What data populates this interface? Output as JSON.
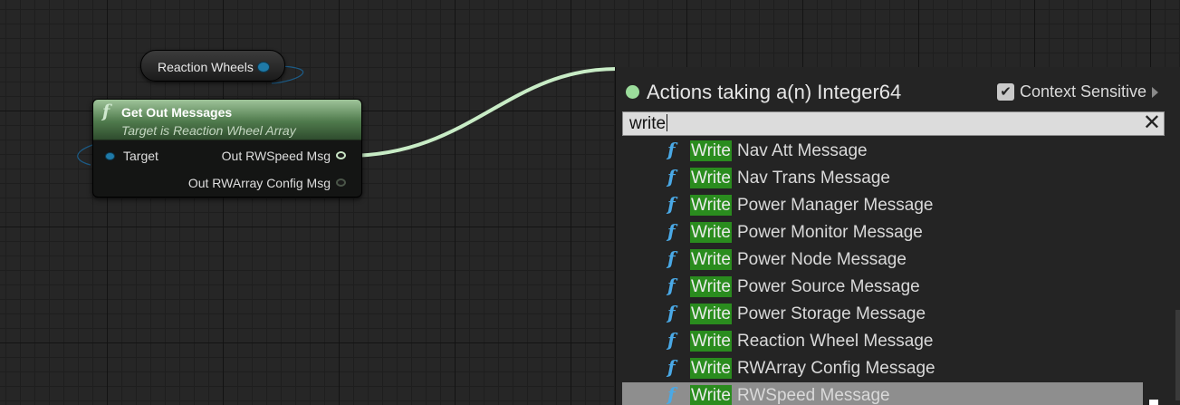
{
  "variable_node": {
    "label": "Reaction Wheels"
  },
  "function_node": {
    "title": "Get Out Messages",
    "subtitle": "Target is Reaction Wheel Array",
    "input_pin": "Target",
    "output_pins": [
      "Out RWSpeed Msg",
      "Out RWArray Config Msg"
    ]
  },
  "action_menu": {
    "title": "Actions taking a(n) Integer64",
    "context_sensitive": {
      "label": "Context Sensitive",
      "checked": true,
      "check_glyph": "✔"
    },
    "search": {
      "value": "write",
      "clear_glyph": "✕"
    },
    "function_glyph": "f",
    "items": [
      {
        "highlight": "Write",
        "rest": "Nav Att Message"
      },
      {
        "highlight": "Write",
        "rest": "Nav Trans Message"
      },
      {
        "highlight": "Write",
        "rest": "Power Manager Message"
      },
      {
        "highlight": "Write",
        "rest": "Power Monitor Message"
      },
      {
        "highlight": "Write",
        "rest": "Power Node Message"
      },
      {
        "highlight": "Write",
        "rest": "Power Source Message"
      },
      {
        "highlight": "Write",
        "rest": "Power Storage Message"
      },
      {
        "highlight": "Write",
        "rest": "Reaction Wheel Message"
      },
      {
        "highlight": "Write",
        "rest": "RWArray Config Message"
      },
      {
        "highlight": "Write",
        "rest": "RWSpeed Message",
        "selected": true
      }
    ]
  },
  "colors": {
    "graph_bg": "#262626",
    "function_header": "#4f7a4c",
    "object_pin": "#1f7aa8",
    "wire": "#c8ecc6",
    "highlight": "#2a8c1e",
    "selection": "#8e8e8e"
  }
}
